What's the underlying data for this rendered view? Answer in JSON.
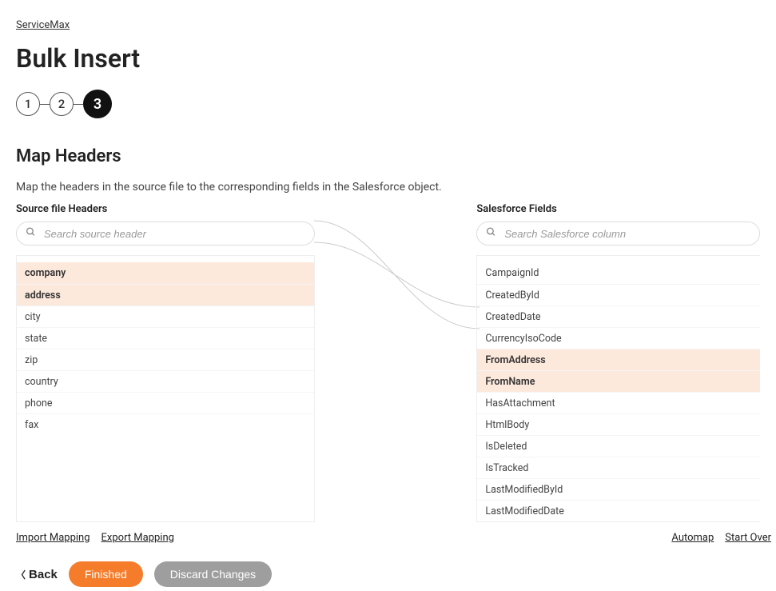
{
  "breadcrumb": "ServiceMax",
  "pageTitle": "Bulk Insert",
  "steps": [
    "1",
    "2",
    "3"
  ],
  "activeStep": 3,
  "sectionTitle": "Map Headers",
  "sectionDesc": "Map the headers in the source file to the corresponding fields in the Salesforce object.",
  "left": {
    "label": "Source file Headers",
    "searchPlaceholder": "Search source header",
    "items": [
      {
        "label": "company",
        "mapped": true
      },
      {
        "label": "address",
        "mapped": true
      },
      {
        "label": "city",
        "mapped": false
      },
      {
        "label": "state",
        "mapped": false
      },
      {
        "label": "zip",
        "mapped": false
      },
      {
        "label": "country",
        "mapped": false
      },
      {
        "label": "phone",
        "mapped": false
      },
      {
        "label": "fax",
        "mapped": false
      }
    ]
  },
  "right": {
    "label": "Salesforce Fields",
    "searchPlaceholder": "Search Salesforce column",
    "items": [
      {
        "label": "CampaignId",
        "mapped": false
      },
      {
        "label": "CreatedById",
        "mapped": false
      },
      {
        "label": "CreatedDate",
        "mapped": false
      },
      {
        "label": "CurrencyIsoCode",
        "mapped": false
      },
      {
        "label": "FromAddress",
        "mapped": true
      },
      {
        "label": "FromName",
        "mapped": true
      },
      {
        "label": "HasAttachment",
        "mapped": false
      },
      {
        "label": "HtmlBody",
        "mapped": false
      },
      {
        "label": "IsDeleted",
        "mapped": false
      },
      {
        "label": "IsTracked",
        "mapped": false
      },
      {
        "label": "LastModifiedById",
        "mapped": false
      },
      {
        "label": "LastModifiedDate",
        "mapped": false
      }
    ]
  },
  "linksLeft": [
    "Import Mapping",
    "Export Mapping"
  ],
  "linksRight": [
    "Automap",
    "Start Over"
  ],
  "footer": {
    "back": "Back",
    "finished": "Finished",
    "discard": "Discard Changes"
  }
}
